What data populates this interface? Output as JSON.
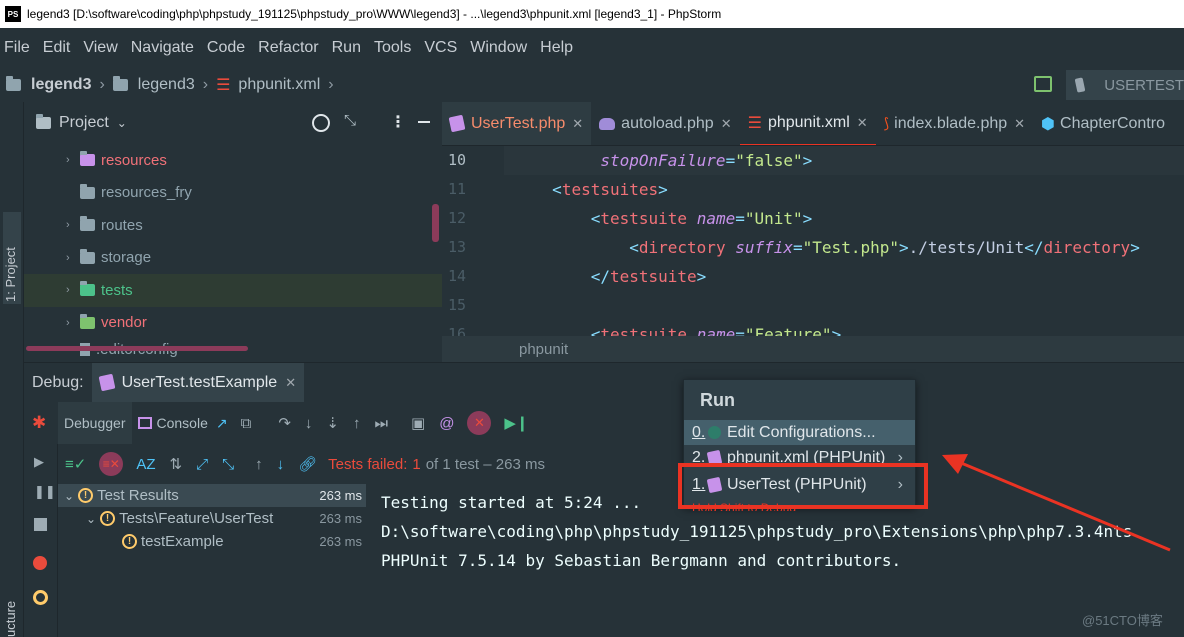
{
  "window": {
    "title": "legend3 [D:\\software\\coding\\php\\phpstudy_191125\\phpstudy_pro\\WWW\\legend3] - ...\\legend3\\phpunit.xml [legend3_1] - PhpStorm",
    "logo": "PS"
  },
  "menu": [
    "File",
    "Edit",
    "View",
    "Navigate",
    "Code",
    "Refactor",
    "Run",
    "Tools",
    "VCS",
    "Window",
    "Help"
  ],
  "nav": {
    "crumb1": "legend3",
    "crumb2": "legend3",
    "crumb3": "phpunit.xml",
    "run_config": "USERTEST"
  },
  "sidebar": {
    "project_label": "1: Project",
    "structure_label": "ucture"
  },
  "project_panel": {
    "title": "Project",
    "items": [
      {
        "label": "resources",
        "color": "#f07178",
        "expandable": true
      },
      {
        "label": "resources_fry",
        "color": "#90a4ae",
        "expandable": false
      },
      {
        "label": "routes",
        "color": "#90a4ae",
        "expandable": true
      },
      {
        "label": "storage",
        "color": "#90a4ae",
        "expandable": true
      },
      {
        "label": "tests",
        "color": "#c3e88d",
        "expandable": true
      },
      {
        "label": "vendor",
        "color": "#f07178",
        "expandable": true
      },
      {
        "label": ".editorconfig",
        "color": "#90a4ae",
        "expandable": false
      }
    ]
  },
  "editor_tabs": [
    {
      "label": "UserTest.php",
      "color": "#f78c6c",
      "icon": "php-class-icon"
    },
    {
      "label": "autoload.php",
      "color": "#b0bec5",
      "icon": "elephant-icon"
    },
    {
      "label": "phpunit.xml",
      "color": "#b0bec5",
      "icon": "xml-icon"
    },
    {
      "label": "index.blade.php",
      "color": "#b0bec5",
      "icon": "laravel-icon"
    },
    {
      "label": "ChapterContro",
      "color": "#b0bec5",
      "icon": "class-icon"
    }
  ],
  "editor": {
    "line_numbers": [
      "10",
      "11",
      "12",
      "13",
      "14",
      "15",
      "16"
    ],
    "breadcrumb": "phpunit"
  },
  "debug": {
    "label": "Debug:",
    "session_tab": "UserTest.testExample",
    "debugger_tab": "Debugger",
    "console_tab": "Console",
    "tests_failed_label": "Tests failed:",
    "tests_failed_count": "1",
    "tests_failed_rest": "of 1 test – 263 ms"
  },
  "test_tree": [
    {
      "label": "Test Results",
      "time": "263 ms",
      "indent": 0
    },
    {
      "label": "Tests\\Feature\\UserTest",
      "time": "263 ms",
      "indent": 1
    },
    {
      "label": "testExample",
      "time": "263 ms",
      "indent": 2
    }
  ],
  "console_lines": [
    "Testing started at 5:24 ...",
    "D:\\software\\coding\\php\\phpstudy_191125\\phpstudy_pro\\Extensions\\php\\php7.3.4nts",
    "PHPUnit 7.5.14 by Sebastian Bergmann and contributors."
  ],
  "run_popup": {
    "title": "Run",
    "items": [
      {
        "num": "0.",
        "label": "Edit Configurations..."
      },
      {
        "num": "2.",
        "label": "phpunit.xml (PHPUnit)"
      },
      {
        "num": "1.",
        "label": "UserTest (PHPUnit)"
      }
    ],
    "hint": "Hold Shift to Debug"
  },
  "watermark": "@51CTO博客",
  "colors": {
    "background": "#263238",
    "accent_red": "#ea3323",
    "tag": "#f07178",
    "attribute": "#c792ea",
    "string": "#c3e88d"
  }
}
